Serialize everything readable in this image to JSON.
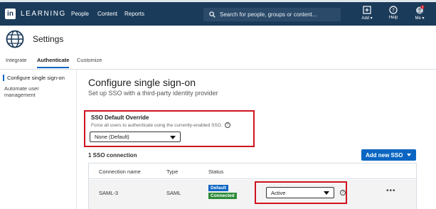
{
  "topbar": {
    "logo_letters": "in",
    "logo_text": "LEARNING",
    "nav": [
      "People",
      "Content",
      "Reports"
    ],
    "search_placeholder": "Search for people, groups or content...",
    "add_label": "Add",
    "help_label": "Help",
    "me_label": "Me",
    "notification_count": "3",
    "icons": [
      "add-icon",
      "help-icon",
      "avatar"
    ]
  },
  "settings": {
    "title": "Settings",
    "icon": "globe-icon"
  },
  "tabs": [
    {
      "label": "Integrate",
      "active": false
    },
    {
      "label": "Authenticate",
      "active": true
    },
    {
      "label": "Customize",
      "active": false
    }
  ],
  "sidebar": {
    "items": [
      {
        "label": "Configure single sign-on",
        "active": true
      },
      {
        "label": "Automate user management",
        "active": false
      }
    ]
  },
  "main": {
    "title": "Configure single sign-on",
    "subtitle": "Set up SSO with a third-party identity provider"
  },
  "override": {
    "title": "SSO Default Override",
    "description": "Force all users to authenticate using the currently-enabled SSO.",
    "selected": "None (Default)"
  },
  "connections": {
    "count_label": "1 SSO connection",
    "add_button": "Add new SSO",
    "headers": [
      "Connection name",
      "Type",
      "Status"
    ],
    "rows": [
      {
        "name": "SAML-3",
        "type": "SAML",
        "badges": [
          "Default",
          "Connected"
        ],
        "status_select": "Active",
        "more": "•••"
      }
    ]
  },
  "colors": {
    "topbar": "#1b3b5a",
    "accent": "#0a66c2",
    "highlight": "#d0131f",
    "connected": "#2e8b3a"
  }
}
